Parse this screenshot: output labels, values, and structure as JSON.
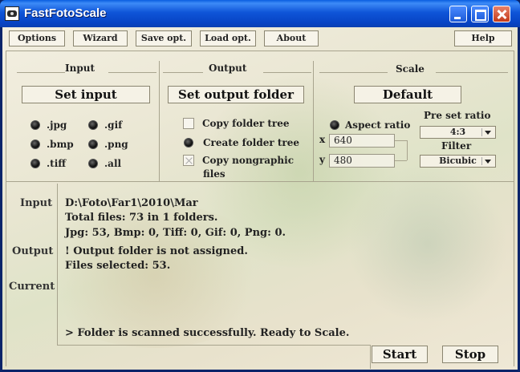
{
  "window": {
    "title": "FastFotoScale"
  },
  "menu": {
    "options": "Options",
    "wizard": "Wizard",
    "save_opt": "Save opt.",
    "load_opt": "Load opt.",
    "about": "About",
    "help": "Help"
  },
  "input_group": {
    "label": "Input",
    "set_input": "Set input",
    "formats": [
      ".jpg",
      ".gif",
      ".bmp",
      ".png",
      ".tiff",
      ".all"
    ]
  },
  "output_group": {
    "label": "Output",
    "set_output": "Set output folder",
    "copy_folder_tree": "Copy folder tree",
    "create_folder_tree": "Create folder tree",
    "copy_nongraphic": "Copy nongraphic",
    "copy_nongraphic_2": "files"
  },
  "scale_group": {
    "label": "Scale",
    "default": "Default",
    "aspect_ratio": "Aspect ratio",
    "x_label": "x",
    "y_label": "y",
    "x_value": "640",
    "y_value": "480",
    "preset_ratio_label": "Pre set ratio",
    "preset_ratio_value": "4:3",
    "filter_label": "Filter",
    "filter_value": "Bicubic"
  },
  "status": {
    "input_label": "Input",
    "output_label": "Output",
    "current_label": "Current",
    "input_lines": [
      "D:\\Foto\\Far1\\2010\\Mar",
      "Total files: 73 in 1 folders.",
      "Jpg: 53, Bmp: 0, Tiff: 0, Gif: 0, Png: 0."
    ],
    "output_lines": [
      "! Output folder is not assigned.",
      "Files selected: 53."
    ],
    "message": "> Folder is scanned successfully. Ready to Scale."
  },
  "actions": {
    "start": "Start",
    "stop": "Stop"
  }
}
